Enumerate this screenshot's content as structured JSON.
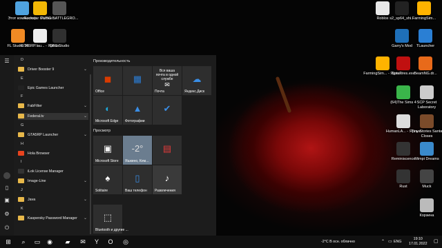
{
  "desktop_left": [
    {
      "label": "Этот компьютер",
      "icon": "computer-icon",
      "color": "#4fa3e0"
    },
    {
      "label": "Rockstar Games ...",
      "icon": "rockstar-icon",
      "color": "#f2b705"
    },
    {
      "label": "PUBG BATTLEGRO...",
      "icon": "pubg-icon",
      "color": "#555555"
    },
    {
      "label": "FL Studio 20",
      "icon": "flstudio-icon",
      "color": "#f08a24"
    },
    {
      "label": "GTA5RP.lau... - Ярлык",
      "icon": "file-icon",
      "color": "#eeeeee"
    },
    {
      "label": "OBS Studio",
      "icon": "obs-icon",
      "color": "#303030"
    }
  ],
  "desktop_right": [
    {
      "label": "Roblox",
      "icon": "roblox-icon",
      "color": "#e8e8e8"
    },
    {
      "label": "s2_sp64_shi...",
      "icon": "callofduty-icon",
      "color": "#222222"
    },
    {
      "label": "FarmingSim...",
      "icon": "farmingsim-icon",
      "color": "#ffb300"
    },
    {
      "label": "Garry's Mod",
      "icon": "garrysmod-icon",
      "color": "#1e6fb8"
    },
    {
      "label": "TLauncher",
      "icon": "tlauncher-icon",
      "color": "#2a7fd4"
    },
    {
      "label": "FarmingSim... - Ярлык",
      "icon": "farmingsim-icon",
      "color": "#ffb300"
    },
    {
      "label": "SpinTires.exe",
      "icon": "spintires-icon",
      "color": "#c01010"
    },
    {
      "label": "BeamNG.dr...",
      "icon": "beamng-icon",
      "color": "#e86a1a"
    },
    {
      "label": "(64)The Sims 4",
      "icon": "sims-icon",
      "color": "#3ab54a"
    },
    {
      "label": "SCP Secret Laboratory",
      "icon": "scp-icon",
      "color": "#cccccc"
    },
    {
      "label": "HumanLA... - Ярлык",
      "icon": "human-icon",
      "color": "#dddddd"
    },
    {
      "label": "Tiny Stories Santa Closes",
      "icon": "game-icon",
      "color": "#7a4b2a"
    },
    {
      "label": "Reminiscence",
      "icon": "game-icon",
      "color": "#333333"
    },
    {
      "label": "Mimpi Dreams",
      "icon": "game-icon",
      "color": "#3a8acb"
    },
    {
      "label": "Rust",
      "icon": "rust-icon",
      "color": "#333333"
    },
    {
      "label": "Muck",
      "icon": "muck-icon",
      "color": "#444444"
    },
    {
      "label": "Корзина",
      "icon": "recycle-bin-icon",
      "color": "#bbbbbb"
    }
  ],
  "start_menu": {
    "apps": [
      {
        "type": "letter",
        "text": "D"
      },
      {
        "type": "folder",
        "text": "Driver Booster 9",
        "expand": true
      },
      {
        "type": "letter",
        "text": "E"
      },
      {
        "type": "app",
        "text": "Epic Games Launcher",
        "color": "#222222"
      },
      {
        "type": "letter",
        "text": "F"
      },
      {
        "type": "folder",
        "text": "FabFilter",
        "expand": true
      },
      {
        "type": "folder",
        "text": "Federal.tv",
        "expand": true,
        "highlight": true
      },
      {
        "type": "letter",
        "text": "G"
      },
      {
        "type": "folder",
        "text": "GTA5RP Launcher",
        "expand": true
      },
      {
        "type": "letter",
        "text": "H"
      },
      {
        "type": "app",
        "text": "Hola Browser",
        "color": "#e8431e"
      },
      {
        "type": "letter",
        "text": "I"
      },
      {
        "type": "app",
        "text": "iLok License Manager",
        "color": "#333333"
      },
      {
        "type": "folder",
        "text": "Image-Line",
        "expand": true
      },
      {
        "type": "letter",
        "text": "J"
      },
      {
        "type": "folder",
        "text": "Java",
        "expand": true
      },
      {
        "type": "letter",
        "text": "K"
      },
      {
        "type": "folder",
        "text": "Kaspersky Password Manager",
        "expand": true
      }
    ],
    "groups": [
      "Производительность",
      "Просмотр"
    ],
    "tiles": [
      {
        "label": "Office",
        "icon": "office-icon",
        "color": "#d83b01",
        "glyph": "◼"
      },
      {
        "label": "",
        "icon": "office-apps-icon",
        "color": "#2b7cd3",
        "glyph": "▦"
      },
      {
        "label": "Вся ваша почта в одной службе",
        "icon": "mail-info-icon",
        "color": "#ffffff",
        "glyph": ""
      },
      {
        "label": "Почта",
        "icon": "mail-icon",
        "color": "#ffffff",
        "glyph": "✉"
      },
      {
        "label": "Яндекс.Диск",
        "icon": "yandex-disk-icon",
        "color": "#3a8ee6",
        "glyph": "☁"
      },
      {
        "label": "Microsoft Edge",
        "icon": "edge-icon",
        "color": "#1fa7d8",
        "glyph": "◐"
      },
      {
        "label": "Фотографии",
        "icon": "photos-icon",
        "color": "#3a8ee6",
        "glyph": "▲"
      },
      {
        "label": "",
        "icon": "checkmark-icon",
        "color": "#3a8ee6",
        "glyph": "✔"
      },
      {
        "label": "Microsoft Store",
        "icon": "store-icon",
        "color": "#f3f3f3",
        "glyph": "▣"
      },
      {
        "label": "Яшкино, Кем...",
        "icon": "weather-icon",
        "color": "#dddddd",
        "glyph": "-2°"
      },
      {
        "label": "",
        "icon": "news-icon",
        "color": "#e23b3b",
        "glyph": "▤"
      },
      {
        "label": "Solitaire",
        "icon": "solitaire-icon",
        "color": "#ffffff",
        "glyph": "♠"
      },
      {
        "label": "Ваш телефон",
        "icon": "phone-icon",
        "color": "#3a8ee6",
        "glyph": "▯"
      },
      {
        "label": "Развлечения",
        "icon": "entertainment-icon",
        "color": "#ffffff",
        "glyph": "♪"
      },
      {
        "label": "Bluetooth и другие ...",
        "icon": "bluetooth-icon",
        "color": "#ffffff",
        "glyph": "⬚"
      }
    ]
  },
  "taskbar": {
    "weather": "-2°C  В осн. облачно",
    "language": "ENG",
    "time": "19:10",
    "date": "17.01.2022",
    "apps": [
      "windows-start-icon",
      "search-icon",
      "task-view-icon",
      "alice-icon",
      "file-explorer-icon",
      "mail-icon",
      "yandex-browser-icon",
      "opera-icon",
      "obs-icon"
    ]
  }
}
